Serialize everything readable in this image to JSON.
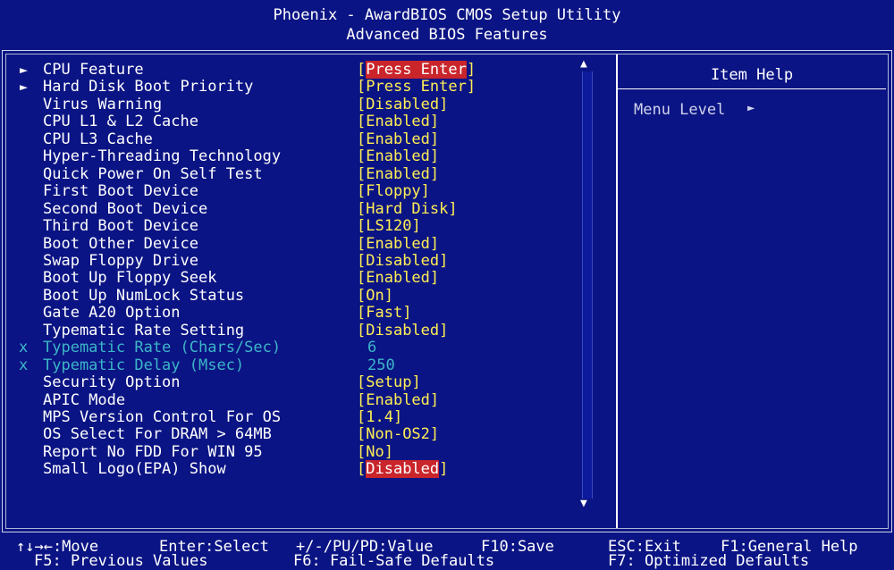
{
  "header": {
    "title": "Phoenix - AwardBIOS CMOS Setup Utility",
    "subtitle": "Advanced BIOS Features"
  },
  "settings": [
    {
      "label": "CPU Feature",
      "value": "Press Enter",
      "submenu": true,
      "highlighted": true,
      "disabled": false
    },
    {
      "label": "Hard Disk Boot Priority",
      "value": "Press Enter",
      "submenu": true,
      "highlighted": false,
      "disabled": false
    },
    {
      "label": "Virus Warning",
      "value": "Disabled",
      "submenu": false,
      "highlighted": false,
      "disabled": false
    },
    {
      "label": "CPU L1 & L2 Cache",
      "value": "Enabled",
      "submenu": false,
      "highlighted": false,
      "disabled": false
    },
    {
      "label": "CPU L3 Cache",
      "value": "Enabled",
      "submenu": false,
      "highlighted": false,
      "disabled": false
    },
    {
      "label": "Hyper-Threading Technology",
      "value": "Enabled",
      "submenu": false,
      "highlighted": false,
      "disabled": false
    },
    {
      "label": "Quick Power On Self Test",
      "value": "Enabled",
      "submenu": false,
      "highlighted": false,
      "disabled": false
    },
    {
      "label": "First Boot Device",
      "value": "Floppy",
      "submenu": false,
      "highlighted": false,
      "disabled": false
    },
    {
      "label": "Second Boot Device",
      "value": "Hard Disk",
      "submenu": false,
      "highlighted": false,
      "disabled": false
    },
    {
      "label": "Third Boot Device",
      "value": "LS120",
      "submenu": false,
      "highlighted": false,
      "disabled": false
    },
    {
      "label": "Boot Other Device",
      "value": "Enabled",
      "submenu": false,
      "highlighted": false,
      "disabled": false
    },
    {
      "label": "Swap Floppy Drive",
      "value": "Disabled",
      "submenu": false,
      "highlighted": false,
      "disabled": false
    },
    {
      "label": "Boot Up Floppy Seek",
      "value": "Enabled",
      "submenu": false,
      "highlighted": false,
      "disabled": false
    },
    {
      "label": "Boot Up NumLock Status",
      "value": "On",
      "submenu": false,
      "highlighted": false,
      "disabled": false
    },
    {
      "label": "Gate A20 Option",
      "value": "Fast",
      "submenu": false,
      "highlighted": false,
      "disabled": false
    },
    {
      "label": "Typematic Rate Setting",
      "value": "Disabled",
      "submenu": false,
      "highlighted": false,
      "disabled": false
    },
    {
      "label": "Typematic Rate (Chars/Sec)",
      "value": "6",
      "submenu": false,
      "highlighted": false,
      "disabled": true
    },
    {
      "label": "Typematic Delay (Msec)",
      "value": "250",
      "submenu": false,
      "highlighted": false,
      "disabled": true
    },
    {
      "label": "Security Option",
      "value": "Setup",
      "submenu": false,
      "highlighted": false,
      "disabled": false
    },
    {
      "label": "APIC Mode",
      "value": "Enabled",
      "submenu": false,
      "highlighted": false,
      "disabled": false
    },
    {
      "label": "MPS Version Control For OS",
      "value": "1.4",
      "submenu": false,
      "highlighted": false,
      "disabled": false
    },
    {
      "label": "OS Select For DRAM > 64MB",
      "value": "Non-OS2",
      "submenu": false,
      "highlighted": false,
      "disabled": false
    },
    {
      "label": "Report No FDD For WIN 95",
      "value": "No",
      "submenu": false,
      "highlighted": false,
      "disabled": false
    },
    {
      "label": "Small Logo(EPA) Show",
      "value": "Disabled",
      "submenu": false,
      "highlighted": true,
      "disabled": false
    }
  ],
  "help_panel": {
    "title": "Item Help",
    "menu_level_label": "Menu Level"
  },
  "footer": {
    "move": "↑↓→←:Move",
    "select": "Enter:Select",
    "value": "+/-/PU/PD:Value",
    "save": "F10:Save",
    "exit": "ESC:Exit",
    "help": "F1:General Help",
    "previous": "F5: Previous Values",
    "failsafe": "F6: Fail-Safe Defaults",
    "optimized": "F7: Optimized Defaults"
  },
  "colors": {
    "background": "#0b1484",
    "value_text": "#ffee55",
    "disabled_text": "#3cb6c8",
    "highlight": "#c9252b"
  },
  "icons": {
    "submenu": "right-triangle-icon",
    "disabled_mark": "x-icon",
    "scroll_up": "up-triangle-icon",
    "scroll_down": "down-triangle-icon"
  }
}
